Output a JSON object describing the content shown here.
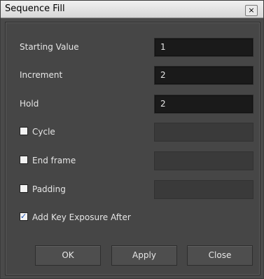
{
  "window": {
    "title": "Sequence Fill",
    "close_glyph": "×"
  },
  "fields": {
    "starting_value": {
      "label": "Starting Value",
      "value": "1"
    },
    "increment": {
      "label": "Increment",
      "value": "2"
    },
    "hold": {
      "label": "Hold",
      "value": "2"
    }
  },
  "options": {
    "cycle": {
      "label": "Cycle",
      "checked": false
    },
    "end_frame": {
      "label": "End frame",
      "checked": false
    },
    "padding": {
      "label": "Padding",
      "checked": false
    },
    "add_key_exposure_after": {
      "label": "Add Key Exposure After",
      "checked": true
    }
  },
  "buttons": {
    "ok": "OK",
    "apply": "Apply",
    "close": "Close"
  }
}
